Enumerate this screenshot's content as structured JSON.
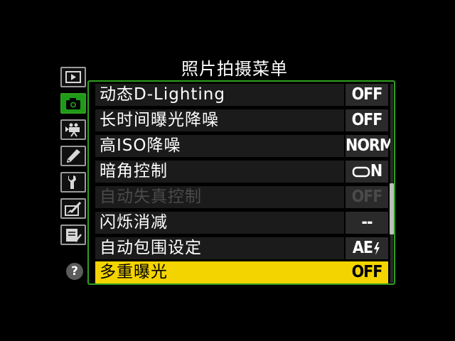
{
  "menu": {
    "title": "照片拍摄菜单"
  },
  "tabs": [
    {
      "name": "playback-menu-tab",
      "icon": "playback-icon",
      "active": false
    },
    {
      "name": "shooting-menu-tab",
      "icon": "camera-icon",
      "active": true
    },
    {
      "name": "movie-menu-tab",
      "icon": "movie-camera-icon",
      "active": false
    },
    {
      "name": "custom-settings-tab",
      "icon": "pencil-icon",
      "active": false
    },
    {
      "name": "setup-menu-tab",
      "icon": "wrench-icon",
      "active": false
    },
    {
      "name": "retouch-menu-tab",
      "icon": "retouch-icon",
      "active": false
    },
    {
      "name": "my-menu-tab",
      "icon": "my-menu-icon",
      "active": false
    },
    {
      "name": "help-tab",
      "icon": "help-icon",
      "label": "?"
    }
  ],
  "items": [
    {
      "label": "动态D-Lighting",
      "value": "OFF",
      "state": "normal"
    },
    {
      "label": "长时间曝光降噪",
      "value": "OFF",
      "state": "normal"
    },
    {
      "label": "高ISO降噪",
      "value": "NORM",
      "state": "normal"
    },
    {
      "label": "暗角控制",
      "value": "N",
      "value_icon": "vignette-frame-icon",
      "state": "normal"
    },
    {
      "label": "自动失真控制",
      "value": "OFF",
      "state": "disabled"
    },
    {
      "label": "闪烁消减",
      "value": "--",
      "state": "normal"
    },
    {
      "label": "自动包围设定",
      "value": "AE",
      "value_icon": "flash-bolt-icon",
      "state": "normal"
    },
    {
      "label": "多重曝光",
      "value": "OFF",
      "state": "selected"
    }
  ],
  "colors": {
    "accent_green": "#2ea01e",
    "highlight_yellow": "#f4d400",
    "disabled_text": "#4a4a4a"
  }
}
